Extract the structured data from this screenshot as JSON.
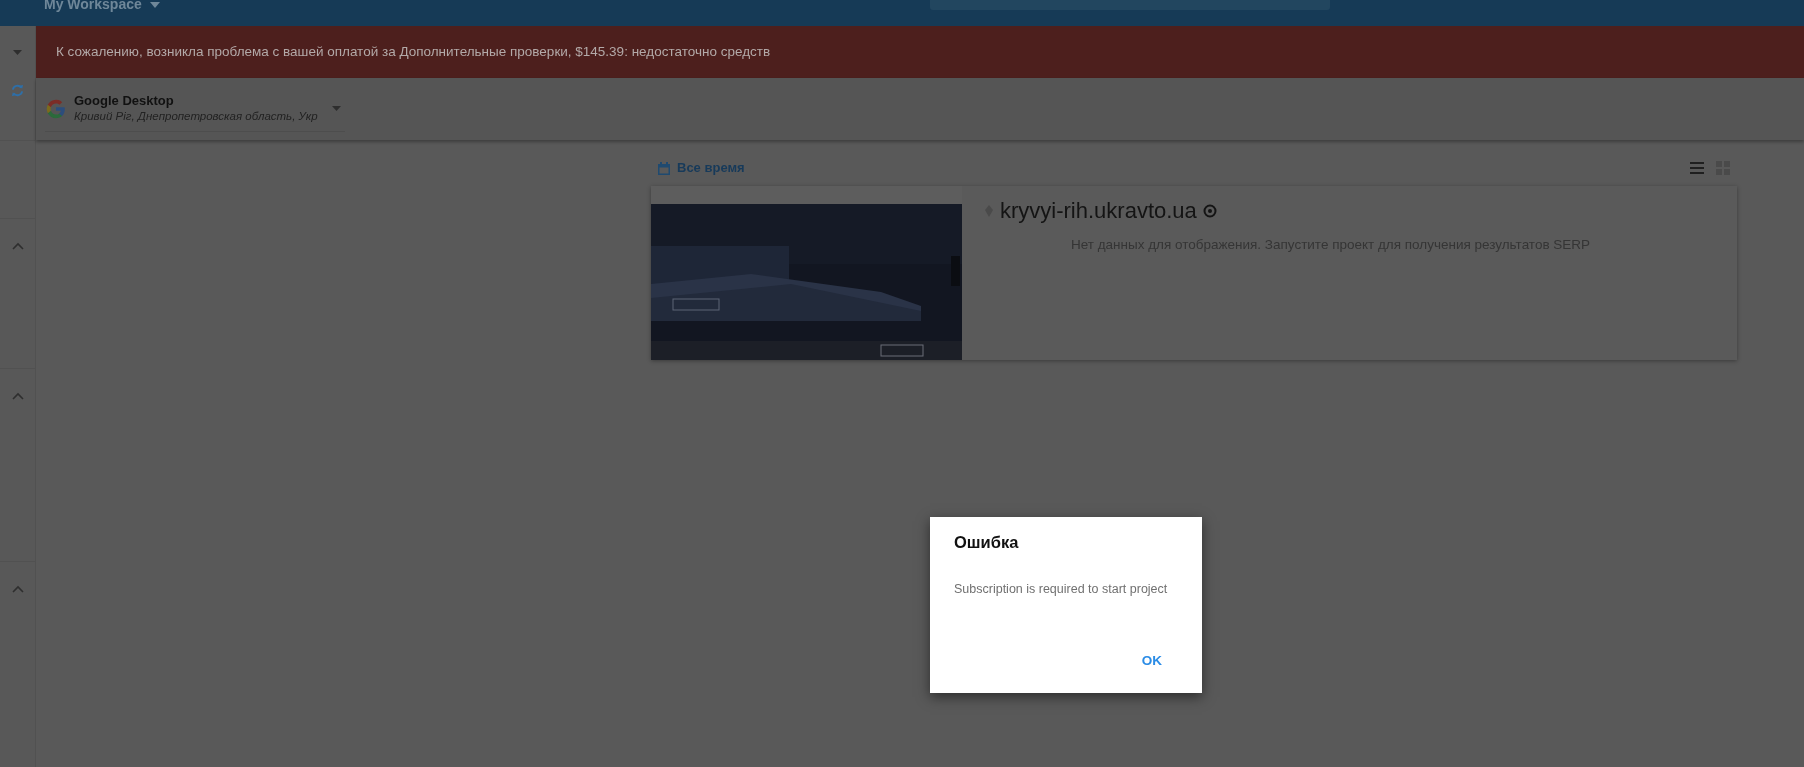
{
  "top_bar": {
    "workspace": "My Workspace"
  },
  "alert": {
    "message": "К сожалению, возникла проблема с вашей оплатой за Дополнительные проверки, $145.39: недостаточно средств"
  },
  "engine_selector": {
    "title": "Google Desktop",
    "location": "Кривий Ріг, Днепропетровская область, Укр"
  },
  "toolbar": {
    "date_filter": "Все время",
    "views": [
      {
        "kind": "list",
        "selected": true
      },
      {
        "kind": "grid",
        "selected": false
      }
    ]
  },
  "project_card": {
    "domain": "kryvyi-rih.ukravto.ua",
    "message": "Нет данных для отображения. Запустите проект для получения результатов SERP"
  },
  "dialog": {
    "title": "Ошибка",
    "message": "Subscription is required to start project",
    "button": "OK"
  }
}
